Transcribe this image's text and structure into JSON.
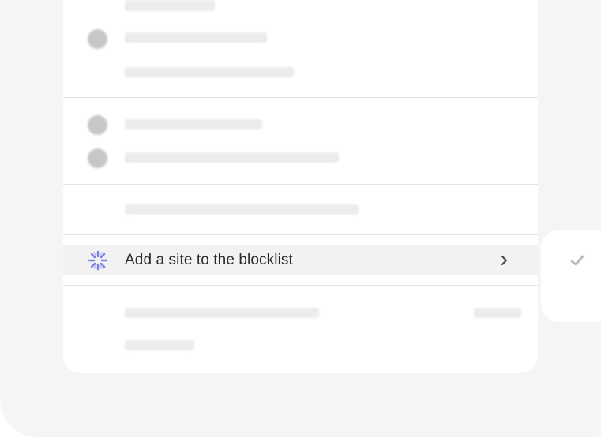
{
  "menu": {
    "add_site_label": "Add a site to the blocklist",
    "add_site_icon": "sparkle-burst-icon",
    "chevron_icon": "chevron-right-icon",
    "accent_color": "#7b7fe6"
  },
  "side_card": {
    "icon": "checkmark-icon"
  }
}
